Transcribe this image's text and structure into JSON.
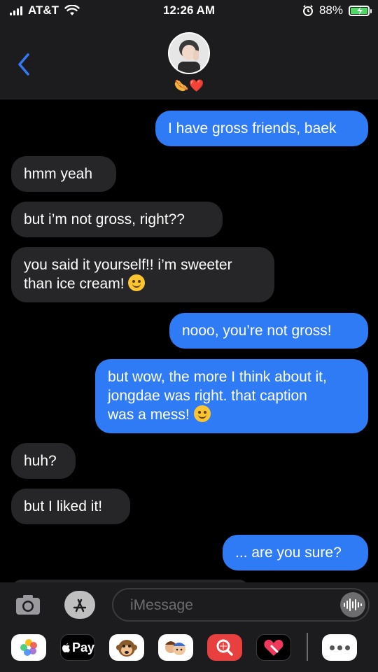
{
  "status_bar": {
    "carrier": "AT&T",
    "time": "12:26 AM",
    "battery": "88%"
  },
  "header": {
    "contact_emoji": "🌭❤️"
  },
  "messages": [
    {
      "dir": "out",
      "text": "I have gross friends, baek"
    },
    {
      "dir": "in",
      "text": "hmm yeah"
    },
    {
      "dir": "in",
      "text": "but i’m not gross, right??"
    },
    {
      "dir": "in",
      "line1": "you said it yourself!! i’m sweeter",
      "line2": "than ice cream! ",
      "emoji": "yum-emoji"
    },
    {
      "dir": "out",
      "text": "nooo, you’re not gross!"
    },
    {
      "dir": "out",
      "line1": "but wow, the more I think about it,",
      "line2": "jongdae was right. that caption",
      "line3": "was a mess! ",
      "emoji": "sweat-smile-emoji"
    },
    {
      "dir": "in",
      "text": "huh?"
    },
    {
      "dir": "in",
      "text": "but I liked it!"
    },
    {
      "dir": "out",
      "text": "... are you sure?"
    }
  ],
  "input": {
    "placeholder": "iMessage"
  },
  "apps": {
    "pay_label": "Pay"
  },
  "colors": {
    "outgoing": "#2f7bf6",
    "incoming": "#262628",
    "accent": "#3478f6"
  }
}
